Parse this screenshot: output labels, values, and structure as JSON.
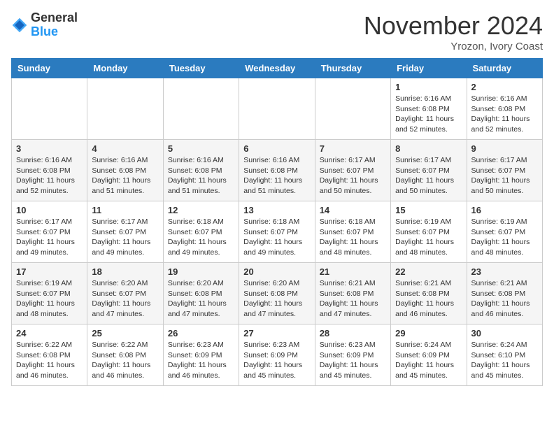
{
  "header": {
    "logo_line1": "General",
    "logo_line2": "Blue",
    "month": "November 2024",
    "location": "Yrozon, Ivory Coast"
  },
  "weekdays": [
    "Sunday",
    "Monday",
    "Tuesday",
    "Wednesday",
    "Thursday",
    "Friday",
    "Saturday"
  ],
  "weeks": [
    [
      {
        "day": "",
        "info": ""
      },
      {
        "day": "",
        "info": ""
      },
      {
        "day": "",
        "info": ""
      },
      {
        "day": "",
        "info": ""
      },
      {
        "day": "",
        "info": ""
      },
      {
        "day": "1",
        "info": "Sunrise: 6:16 AM\nSunset: 6:08 PM\nDaylight: 11 hours\nand 52 minutes."
      },
      {
        "day": "2",
        "info": "Sunrise: 6:16 AM\nSunset: 6:08 PM\nDaylight: 11 hours\nand 52 minutes."
      }
    ],
    [
      {
        "day": "3",
        "info": "Sunrise: 6:16 AM\nSunset: 6:08 PM\nDaylight: 11 hours\nand 52 minutes."
      },
      {
        "day": "4",
        "info": "Sunrise: 6:16 AM\nSunset: 6:08 PM\nDaylight: 11 hours\nand 51 minutes."
      },
      {
        "day": "5",
        "info": "Sunrise: 6:16 AM\nSunset: 6:08 PM\nDaylight: 11 hours\nand 51 minutes."
      },
      {
        "day": "6",
        "info": "Sunrise: 6:16 AM\nSunset: 6:08 PM\nDaylight: 11 hours\nand 51 minutes."
      },
      {
        "day": "7",
        "info": "Sunrise: 6:17 AM\nSunset: 6:07 PM\nDaylight: 11 hours\nand 50 minutes."
      },
      {
        "day": "8",
        "info": "Sunrise: 6:17 AM\nSunset: 6:07 PM\nDaylight: 11 hours\nand 50 minutes."
      },
      {
        "day": "9",
        "info": "Sunrise: 6:17 AM\nSunset: 6:07 PM\nDaylight: 11 hours\nand 50 minutes."
      }
    ],
    [
      {
        "day": "10",
        "info": "Sunrise: 6:17 AM\nSunset: 6:07 PM\nDaylight: 11 hours\nand 49 minutes."
      },
      {
        "day": "11",
        "info": "Sunrise: 6:17 AM\nSunset: 6:07 PM\nDaylight: 11 hours\nand 49 minutes."
      },
      {
        "day": "12",
        "info": "Sunrise: 6:18 AM\nSunset: 6:07 PM\nDaylight: 11 hours\nand 49 minutes."
      },
      {
        "day": "13",
        "info": "Sunrise: 6:18 AM\nSunset: 6:07 PM\nDaylight: 11 hours\nand 49 minutes."
      },
      {
        "day": "14",
        "info": "Sunrise: 6:18 AM\nSunset: 6:07 PM\nDaylight: 11 hours\nand 48 minutes."
      },
      {
        "day": "15",
        "info": "Sunrise: 6:19 AM\nSunset: 6:07 PM\nDaylight: 11 hours\nand 48 minutes."
      },
      {
        "day": "16",
        "info": "Sunrise: 6:19 AM\nSunset: 6:07 PM\nDaylight: 11 hours\nand 48 minutes."
      }
    ],
    [
      {
        "day": "17",
        "info": "Sunrise: 6:19 AM\nSunset: 6:07 PM\nDaylight: 11 hours\nand 48 minutes."
      },
      {
        "day": "18",
        "info": "Sunrise: 6:20 AM\nSunset: 6:07 PM\nDaylight: 11 hours\nand 47 minutes."
      },
      {
        "day": "19",
        "info": "Sunrise: 6:20 AM\nSunset: 6:08 PM\nDaylight: 11 hours\nand 47 minutes."
      },
      {
        "day": "20",
        "info": "Sunrise: 6:20 AM\nSunset: 6:08 PM\nDaylight: 11 hours\nand 47 minutes."
      },
      {
        "day": "21",
        "info": "Sunrise: 6:21 AM\nSunset: 6:08 PM\nDaylight: 11 hours\nand 47 minutes."
      },
      {
        "day": "22",
        "info": "Sunrise: 6:21 AM\nSunset: 6:08 PM\nDaylight: 11 hours\nand 46 minutes."
      },
      {
        "day": "23",
        "info": "Sunrise: 6:21 AM\nSunset: 6:08 PM\nDaylight: 11 hours\nand 46 minutes."
      }
    ],
    [
      {
        "day": "24",
        "info": "Sunrise: 6:22 AM\nSunset: 6:08 PM\nDaylight: 11 hours\nand 46 minutes."
      },
      {
        "day": "25",
        "info": "Sunrise: 6:22 AM\nSunset: 6:08 PM\nDaylight: 11 hours\nand 46 minutes."
      },
      {
        "day": "26",
        "info": "Sunrise: 6:23 AM\nSunset: 6:09 PM\nDaylight: 11 hours\nand 46 minutes."
      },
      {
        "day": "27",
        "info": "Sunrise: 6:23 AM\nSunset: 6:09 PM\nDaylight: 11 hours\nand 45 minutes."
      },
      {
        "day": "28",
        "info": "Sunrise: 6:23 AM\nSunset: 6:09 PM\nDaylight: 11 hours\nand 45 minutes."
      },
      {
        "day": "29",
        "info": "Sunrise: 6:24 AM\nSunset: 6:09 PM\nDaylight: 11 hours\nand 45 minutes."
      },
      {
        "day": "30",
        "info": "Sunrise: 6:24 AM\nSunset: 6:10 PM\nDaylight: 11 hours\nand 45 minutes."
      }
    ]
  ]
}
